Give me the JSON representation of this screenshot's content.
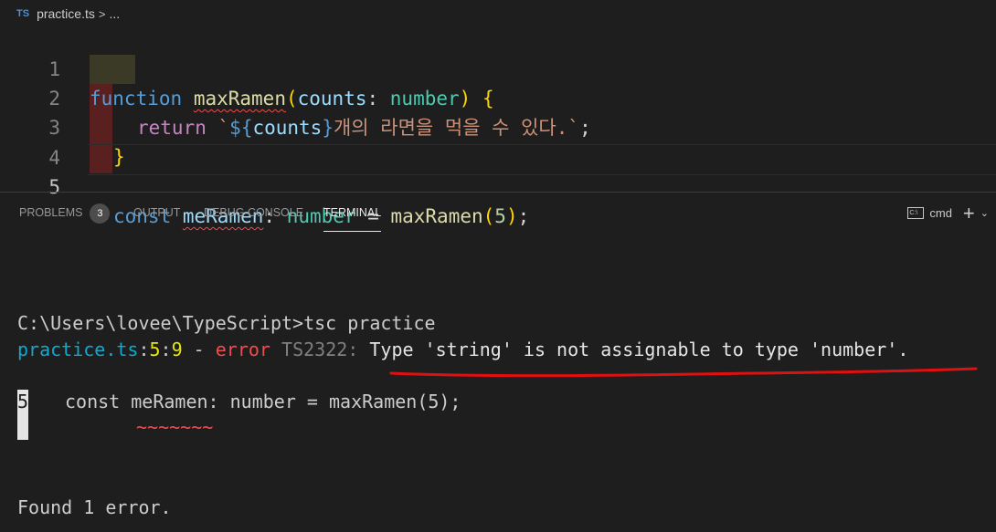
{
  "breadcrumb": {
    "lang_badge": "TS",
    "file": "practice.ts",
    "separator": ">",
    "more": "..."
  },
  "editor": {
    "line_numbers": [
      "1",
      "2",
      "3",
      "4",
      "5"
    ],
    "line1": {
      "kw": "function",
      "fn": "maxRamen",
      "open": "(",
      "param": "counts",
      "colon": ": ",
      "type": "number",
      "close": ")",
      "brace": " {"
    },
    "line2": {
      "kw": "return",
      "tick_open": "`",
      "tmpl_open": "${",
      "var": "counts",
      "tmpl_close": "}",
      "text": "개의 라면을 먹을 수 있다.",
      "tick_close": "`",
      "semi": ";"
    },
    "line3": {
      "brace": "}"
    },
    "line5": {
      "kw": "const",
      "var": "meRamen",
      "colon": ": ",
      "type": "number",
      "eq": " = ",
      "fn": "maxRamen",
      "open": "(",
      "num": "5",
      "close": ")",
      "semi": ";"
    }
  },
  "panel": {
    "tabs": [
      {
        "label": "PROBLEMS",
        "badge": "3"
      },
      {
        "label": "OUTPUT"
      },
      {
        "label": "DEBUG CONSOLE"
      },
      {
        "label": "TERMINAL"
      }
    ],
    "shell_label": "cmd",
    "shell_icon_text": "C:\\",
    "add_icon": "+",
    "dropdown_icon": "⌄"
  },
  "terminal": {
    "prompt": "C:\\Users\\lovee\\TypeScript>tsc practice",
    "err_file": "practice.ts",
    "err_colon1": ":",
    "err_line": "5",
    "err_colon2": ":",
    "err_col": "9",
    "err_dash": " - ",
    "err_word": "error",
    "err_code": " TS2322: ",
    "err_msg": "Type 'string' is not assignable to type 'number'.",
    "gutter_num": "5",
    "code_line": "const meRamen: number = maxRamen(5);",
    "tildes": "~~~~~~~",
    "summary": "Found 1 error."
  },
  "colors": {
    "annotation_red": "#e01010",
    "squiggle": "#f14c4c"
  }
}
